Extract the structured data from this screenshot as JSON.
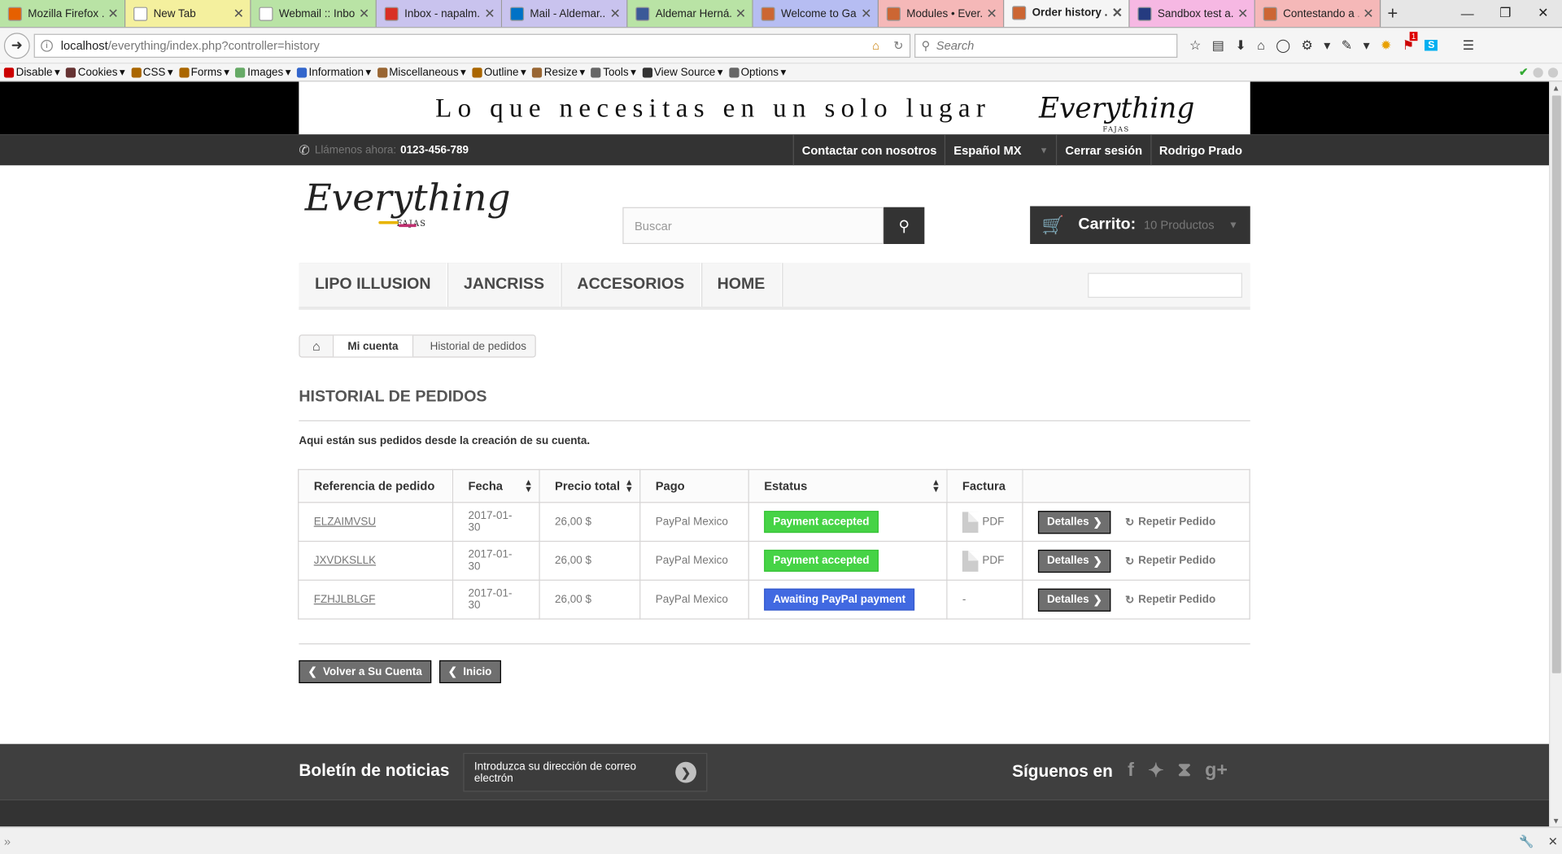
{
  "browser": {
    "tabs": [
      {
        "label": "Mozilla Firefox ...",
        "color": "#e66000",
        "bg": "#b9e3a5"
      },
      {
        "label": "New Tab",
        "color": "#ffffff",
        "bg": "#f4f09e"
      },
      {
        "label": "Webmail :: Inbox",
        "color": "#ffffff",
        "bg": "#b9e3a5"
      },
      {
        "label": "Inbox - napalm...",
        "color": "#d93025",
        "bg": "#c9c3ee"
      },
      {
        "label": "Mail - Aldemar...",
        "color": "#0072c6",
        "bg": "#c9c3ee"
      },
      {
        "label": "Aldemar Herná...",
        "color": "#3b5998",
        "bg": "#b9e3a5"
      },
      {
        "label": "Welcome to Ga...",
        "color": "#cc6633",
        "bg": "#b6bdf2"
      },
      {
        "label": "Modules • Ever...",
        "color": "#cc6633",
        "bg": "#f5b8b8"
      },
      {
        "label": "Order history ...",
        "color": "#cc6633",
        "bg": "#f5f5f5"
      },
      {
        "label": "Sandbox test a...",
        "color": "#253b80",
        "bg": "#f6b8e3"
      },
      {
        "label": "Contestando a ...",
        "color": "#cc6633",
        "bg": "#f5b8b8"
      }
    ],
    "url_host": "localhost",
    "url_path": "/everything/index.php?controller=history",
    "search_placeholder": "Search",
    "devbar": [
      "Disable",
      "Cookies",
      "CSS",
      "Forms",
      "Images",
      "Information",
      "Miscellaneous",
      "Outline",
      "Resize",
      "Tools",
      "View Source",
      "Options"
    ],
    "notification_badge": "1"
  },
  "banner": {
    "slogan": "Lo que necesitas en un solo lugar",
    "logo_text": "Everything",
    "logo_sub": "FAJAS"
  },
  "topnav": {
    "call_label": "Llámenos ahora:",
    "phone": "0123-456-789",
    "contact": "Contactar con nosotros",
    "language": "Español MX",
    "logout": "Cerrar sesión",
    "user": "Rodrigo Prado"
  },
  "header": {
    "logo_text": "Everything",
    "logo_sub": "FAJAS",
    "search_placeholder": "Buscar",
    "cart_label": "Carrito:",
    "cart_count": "10 Productos"
  },
  "menu": [
    "Lipo Illusion",
    "Jancriss",
    "Accesorios",
    "Home"
  ],
  "breadcrumb": {
    "account": "Mi cuenta",
    "current": "Historial de pedidos"
  },
  "page_title": "Historial de pedidos",
  "intro": "Aqui están sus pedidos desde la creación de su cuenta.",
  "table": {
    "headers": [
      "Referencia de pedido",
      "Fecha",
      "Precio total",
      "Pago",
      "Estatus",
      "Factura",
      ""
    ],
    "rows": [
      {
        "ref": "ELZAIMVSU",
        "date": "2017-01-30",
        "total": "26,00 $",
        "payment": "PayPal Mexico",
        "status": "Payment accepted",
        "status_color": "green",
        "invoice": "PDF"
      },
      {
        "ref": "JXVDKSLLK",
        "date": "2017-01-30",
        "total": "26,00 $",
        "payment": "PayPal Mexico",
        "status": "Payment accepted",
        "status_color": "green",
        "invoice": "PDF"
      },
      {
        "ref": "FZHJLBLGF",
        "date": "2017-01-30",
        "total": "26,00 $",
        "payment": "PayPal Mexico",
        "status": "Awaiting PayPal payment",
        "status_color": "blue",
        "invoice": "-"
      }
    ],
    "details_label": "Detalles",
    "reorder_label": "Repetir Pedido"
  },
  "buttons": {
    "back_account": "Volver a Su Cuenta",
    "home": "Inicio"
  },
  "footer": {
    "newsletter_title": "Boletín de noticias",
    "newsletter_placeholder": "Introduzca su dirección de correo electrón",
    "follow_title": "Síguenos en"
  }
}
